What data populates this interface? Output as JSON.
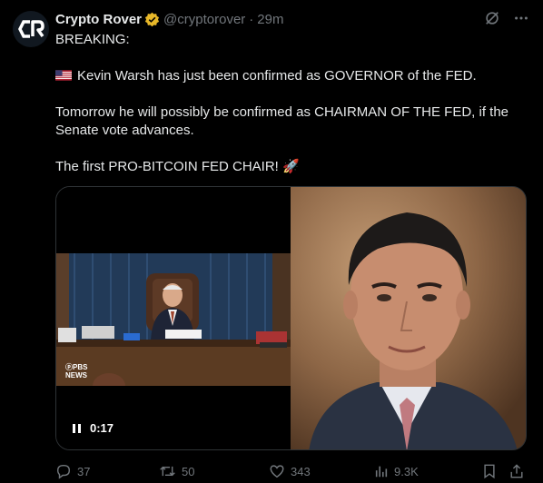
{
  "author": {
    "display_name": "Crypto Rover",
    "handle": "@cryptorover",
    "time_ago": "29m",
    "avatar_initials": "CR"
  },
  "tweet": {
    "line1": "BREAKING:",
    "line2": "Kevin Warsh has just been confirmed as GOVERNOR of the FED.",
    "line3": "Tomorrow he will possibly be confirmed as CHAIRMAN OF THE FED, if the Senate vote advances.",
    "line4": "The first PRO-BITCOIN FED CHAIR! 🚀"
  },
  "media": {
    "video_watermark_line1": "ⓟPBS",
    "video_watermark_line2": "NEWS",
    "video_time": "0:17"
  },
  "actions": {
    "replies": "37",
    "reposts": "50",
    "likes": "343",
    "views": "9.3K"
  },
  "icons": [
    "grok-icon",
    "more-icon",
    "verified-badge-icon",
    "us-flag-icon",
    "reply-icon",
    "repost-icon",
    "like-icon",
    "views-icon",
    "bookmark-icon",
    "share-icon",
    "pause-icon"
  ],
  "colors": {
    "background": "#000000",
    "text": "#e7e9ea",
    "muted": "#71767b",
    "verified": "#e8b829"
  }
}
